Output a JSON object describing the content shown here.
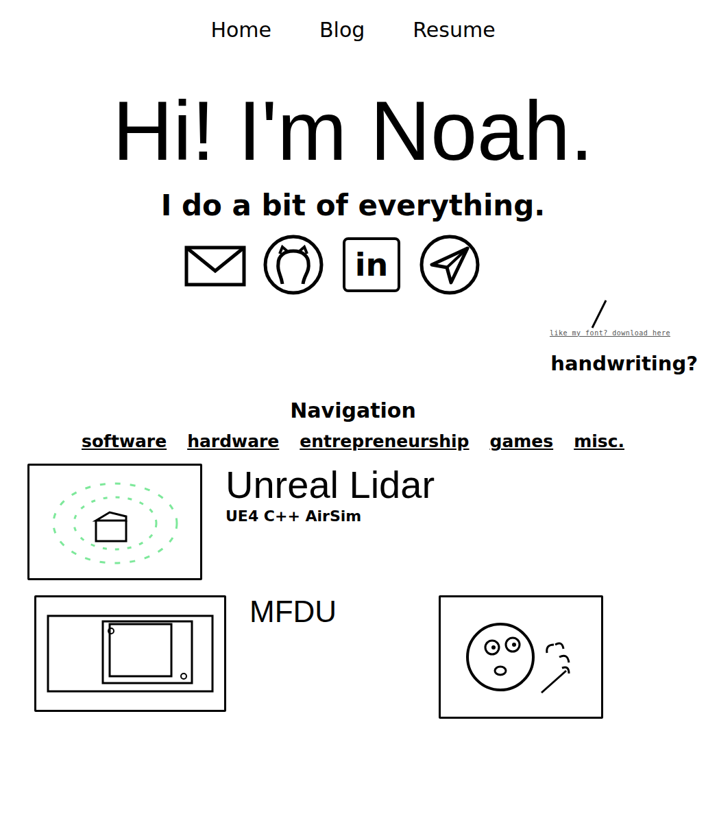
{
  "nav": [
    {
      "label": "Home"
    },
    {
      "label": "Blog"
    },
    {
      "label": "Resume"
    }
  ],
  "hero": {
    "title": "Hi! I'm Noah.",
    "subtitle": "I do a bit of everything."
  },
  "social": [
    {
      "kind": "mail"
    },
    {
      "kind": "github"
    },
    {
      "kind": "linkedin",
      "text": "in"
    },
    {
      "kind": "telegram"
    }
  ],
  "font_promo": {
    "note": "like my font? download here",
    "word": "handwriting?"
  },
  "navigation": {
    "title": "Navigation",
    "categories": [
      "software",
      "hardware",
      "entrepreneurship",
      "games",
      "misc."
    ]
  },
  "projects": [
    {
      "kind": "lidar",
      "title": "Unreal Lidar",
      "tags": "UE4 C++ AirSim",
      "color": "#7de89a"
    },
    {
      "kind": "device",
      "title": "MFDU"
    },
    {
      "kind": "face"
    }
  ]
}
